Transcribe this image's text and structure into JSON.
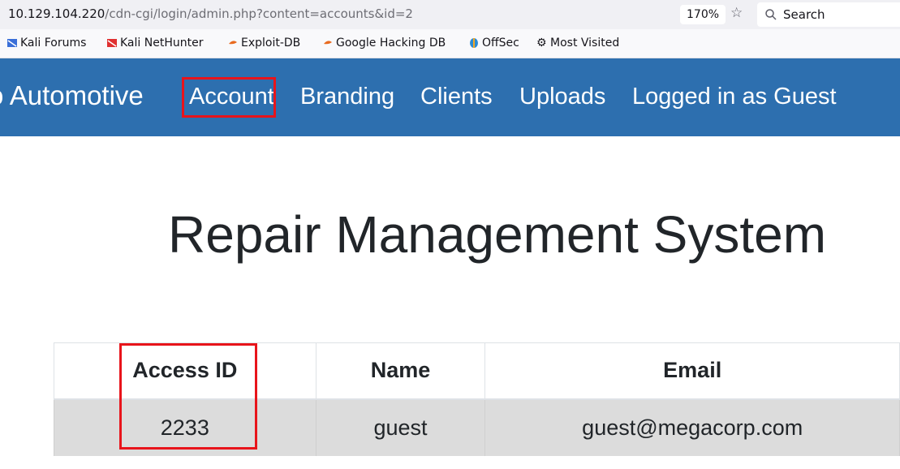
{
  "browser": {
    "url_host": "10.129.104.220",
    "url_path": "/cdn-cgi/login/admin.php?content=accounts&id=2",
    "zoom": "170%",
    "search_label": "Search"
  },
  "bookmarks": [
    {
      "label": "Kali Forums",
      "icon": "kali-dragon-icon"
    },
    {
      "label": "Kali NetHunter",
      "icon": "kali-nethunter-icon"
    },
    {
      "label": "Exploit-DB",
      "icon": "exploit-db-icon"
    },
    {
      "label": "Google Hacking DB",
      "icon": "ghdb-icon"
    },
    {
      "label": "OffSec",
      "icon": "offsec-icon"
    },
    {
      "label": "Most Visited",
      "icon": "gear-icon"
    }
  ],
  "navbar": {
    "brand": "o Automotive",
    "items": [
      "Account",
      "Branding",
      "Clients",
      "Uploads",
      "Logged in as Guest"
    ]
  },
  "page": {
    "title": "Repair Management System"
  },
  "table": {
    "headers": [
      "Access ID",
      "Name",
      "Email"
    ],
    "rows": [
      [
        "2233",
        "guest",
        "guest@megacorp.com"
      ]
    ]
  },
  "colors": {
    "navbar": "#2d6faf",
    "highlight": "#e8141b",
    "row_bg": "#dcdcdc"
  }
}
